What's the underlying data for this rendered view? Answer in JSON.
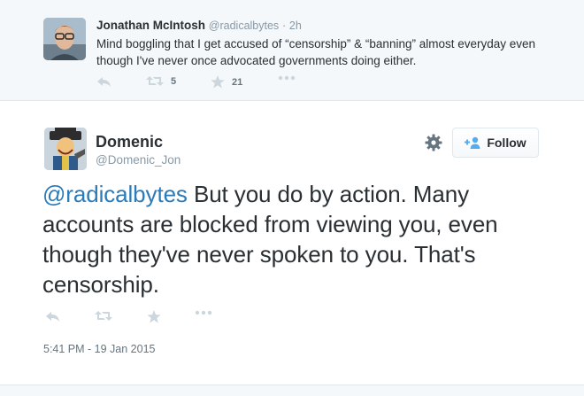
{
  "parent_tweet": {
    "name": "Jonathan McIntosh",
    "handle": "@radicalbytes",
    "separator": "·",
    "age": "2h",
    "text": "Mind boggling that I get accused of “censorship” & “banning” almost everyday even though I've never once advocated governments doing either.",
    "retweet_count": "5",
    "favorite_count": "21"
  },
  "main_tweet": {
    "name": "Domenic",
    "handle": "@Domenic_Jon",
    "follow_label": "Follow",
    "mention": "@radicalbytes",
    "text": " But you do by action. Many accounts are blocked from viewing you, even though they've never spoken to you. That's censorship.",
    "timestamp": "5:41 PM - 19 Jan 2015"
  },
  "colors": {
    "link": "#2b7bb9",
    "icon": "#ccd6dd",
    "muted": "#8899a6",
    "text": "#292f33"
  }
}
